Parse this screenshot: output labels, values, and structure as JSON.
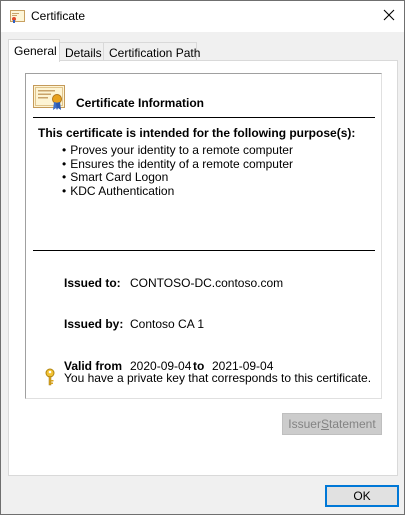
{
  "window": {
    "title": "Certificate",
    "icon": "certificate-icon",
    "close_icon": "close-icon"
  },
  "tabs": [
    {
      "label": "General",
      "active": true
    },
    {
      "label": "Details",
      "active": false
    },
    {
      "label": "Certification Path",
      "active": false
    }
  ],
  "general": {
    "header_icon": "certificate-icon",
    "info_title": "Certificate Information",
    "purpose_heading": "This certificate is intended for the following purpose(s):",
    "purposes": [
      "Proves your identity to a remote computer",
      "Ensures the identity of a remote computer",
      "Smart Card Logon",
      "KDC Authentication"
    ],
    "issued_to_label": "Issued to:",
    "issued_to_value": "CONTOSO-DC.contoso.com",
    "issued_by_label": "Issued by:",
    "issued_by_value": "Contoso CA 1",
    "valid_from_label": "Valid from",
    "valid_from_value": "2020-09-04",
    "valid_to_label": "to",
    "valid_to_value": "2021-09-04",
    "key_icon": "key-icon",
    "private_key_text": "You have a private key that corresponds to this certificate."
  },
  "buttons": {
    "issuer_statement_prefix": "Issuer ",
    "issuer_statement_access_key": "S",
    "issuer_statement_suffix": "tatement",
    "issuer_statement_enabled": false,
    "ok": "OK"
  },
  "colors": {
    "focus_border": "#0078d7",
    "disabled_text": "#838383"
  }
}
